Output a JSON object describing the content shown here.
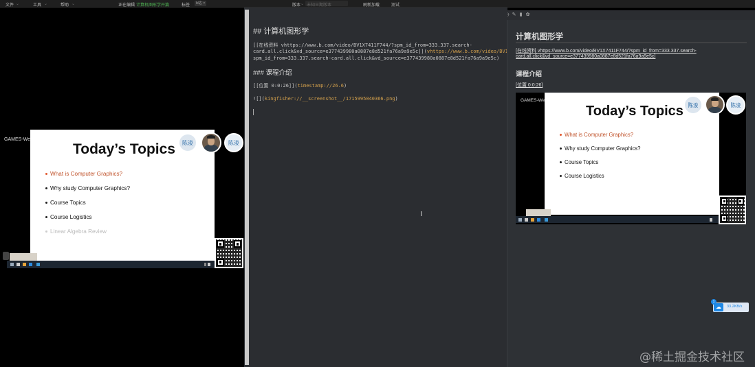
{
  "menu": {
    "file": "文件",
    "tools": "工具",
    "help": "帮助",
    "editing_prefix": "正在编辑",
    "editing_doc": "计算机图形学开篇",
    "tags_label": "标签",
    "tag_value": "b站",
    "version_label": "版本",
    "version_value": "未知日期版本",
    "refresh": "刷新加载",
    "test": "测试"
  },
  "video_slide": {
    "title": "Today’s Topics",
    "items": [
      {
        "text": "What is Computer Graphics?",
        "style": "red"
      },
      {
        "text": "Why study Computer Graphics?",
        "style": "black"
      },
      {
        "text": "Course Topics",
        "style": "black"
      },
      {
        "text": "Course Logistics",
        "style": "black"
      },
      {
        "text": "Linear Algebra Review",
        "style": "grey"
      }
    ],
    "bubble_left": "陈浚",
    "bubble_right": "陈浚",
    "games_label": "GAMES-We"
  },
  "editor": {
    "h2": "## 计算机图形学",
    "link_line1_a": "[[在线资料 vhttps://www.b.com/video/BV1X7411F744/?spm_id_from=333.337.search-",
    "link_line2_a": "card.all.click&vd_source=e377439980a0887e8d521fa76a9a9e5c]](",
    "link_line1_b": "vhttps://www.b.com/video/BV1X7411F744/?",
    "link_line3": "spm_id_from=333.337.search-card.all.click&vd_source=e377439980a0887e8d521fa76a9a9e5c)",
    "h3": "### 课程介绍",
    "ts_a": "[[位置 0:0:26]](",
    "ts_b": "timestamp://26.6",
    "ts_c": ")",
    "img_a": "![](",
    "img_b": "kingfisher://__screenshot__/1715995040366.png",
    "img_c": ")"
  },
  "preview": {
    "h2": "计算机图形学",
    "link1": "[在线资料 vhttps://www.b.com/video/BV1X7411F744/?spm_id_from=333.337.search-",
    "link2": "card.all.click&vd_source=e377439980a0887e8d521fa76a9a9e5c]",
    "h3": "课程介绍",
    "ts": "[位置 0:0:26]",
    "slide_title": "Today’s Topics",
    "items": [
      {
        "text": "What is Computer Graphics?",
        "style": "red"
      },
      {
        "text": "Why study Computer Graphics?",
        "style": "black"
      },
      {
        "text": "Course Topics",
        "style": "black"
      },
      {
        "text": "Course Logistics",
        "style": "black"
      }
    ],
    "bubble_left": "陈浚",
    "bubble_right": "陈浚",
    "games_label": "GAMES-We"
  },
  "cloud": {
    "count": "1",
    "speed": "33.2KB/s"
  },
  "watermark": "@稀土掘金技术社区"
}
